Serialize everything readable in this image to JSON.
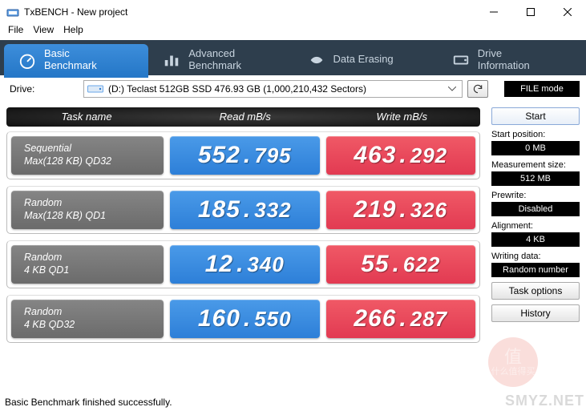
{
  "window": {
    "title": "TxBENCH - New project"
  },
  "menu": {
    "file": "File",
    "view": "View",
    "help": "Help"
  },
  "tabs": {
    "basic": "Basic\nBenchmark",
    "advanced": "Advanced\nBenchmark",
    "erasing": "Data Erasing",
    "drive": "Drive\nInformation"
  },
  "drive": {
    "label": "Drive:",
    "selected": "(D:) Teclast 512GB SSD  476.93 GB (1,000,210,432 Sectors)",
    "filemode_btn": "FILE mode"
  },
  "headers": {
    "task": "Task name",
    "read": "Read mB/s",
    "write": "Write mB/s"
  },
  "rows": [
    {
      "name1": "Sequential",
      "name2": "Max(128 KB) QD32",
      "read_int": "552",
      "read_dec": "795",
      "write_int": "463",
      "write_dec": "292"
    },
    {
      "name1": "Random",
      "name2": "Max(128 KB) QD1",
      "read_int": "185",
      "read_dec": "332",
      "write_int": "219",
      "write_dec": "326"
    },
    {
      "name1": "Random",
      "name2": "4 KB QD1",
      "read_int": "12",
      "read_dec": "340",
      "write_int": "55",
      "write_dec": "622"
    },
    {
      "name1": "Random",
      "name2": "4 KB QD32",
      "read_int": "160",
      "read_dec": "550",
      "write_int": "266",
      "write_dec": "287"
    }
  ],
  "panel": {
    "start": "Start",
    "start_pos_lbl": "Start position:",
    "start_pos_val": "0 MB",
    "meas_lbl": "Measurement size:",
    "meas_val": "512 MB",
    "prewrite_lbl": "Prewrite:",
    "prewrite_val": "Disabled",
    "align_lbl": "Alignment:",
    "align_val": "4 KB",
    "writing_lbl": "Writing data:",
    "writing_val": "Random number",
    "task_opt": "Task options",
    "history": "History"
  },
  "status": "Basic Benchmark finished successfully.",
  "watermark": {
    "badge_top": "值",
    "badge_bot": "什么值得买",
    "text": "SMYZ.NET"
  }
}
